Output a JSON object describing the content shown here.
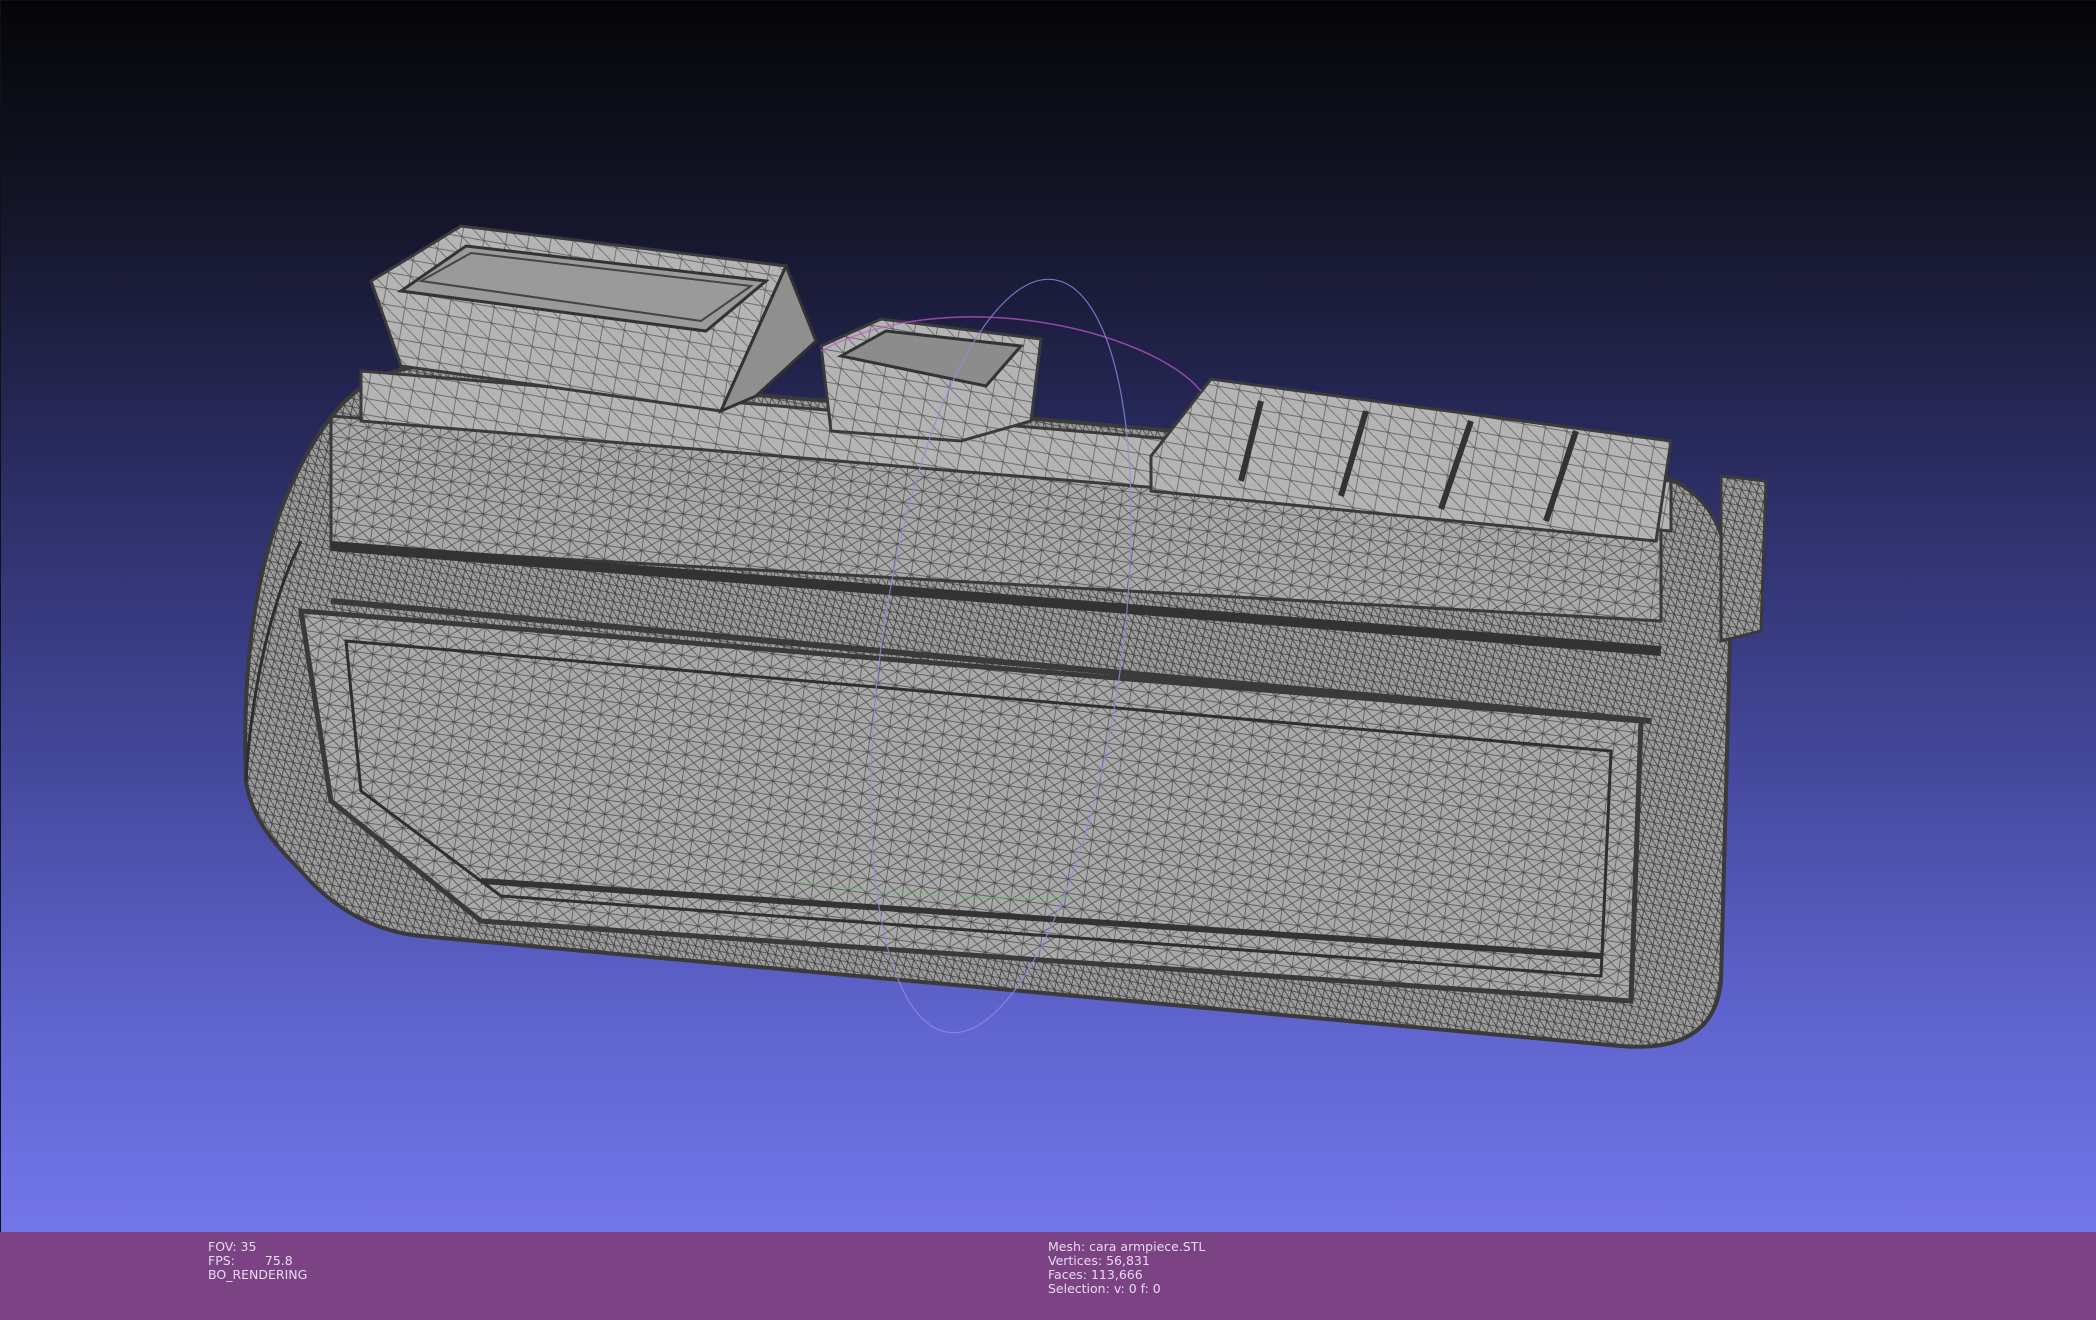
{
  "viewport": {
    "mesh_fill": "#a8a8a8",
    "wire_color": "#3c3c3c",
    "background_top": "#050508",
    "background_bottom": "#7376ea",
    "trackball_colors": [
      "#c45ad0",
      "#8a8fe8",
      "#70c070"
    ]
  },
  "status": {
    "fov_label": "FOV:",
    "fov_value": "35",
    "fps_label": "FPS:",
    "fps_value": "75.8",
    "render_mode": "BO_RENDERING",
    "mesh_label": "Mesh:",
    "mesh_value": "cara armpiece.STL",
    "vertices_label": "Vertices:",
    "vertices_value": "56,831",
    "faces_label": "Faces:",
    "faces_value": "113,666",
    "selection_label": "Selection:",
    "selection_value": "v: 0 f: 0"
  },
  "colors": {
    "status_bar_bg": "#7b4384",
    "status_text": "#e6dced"
  }
}
